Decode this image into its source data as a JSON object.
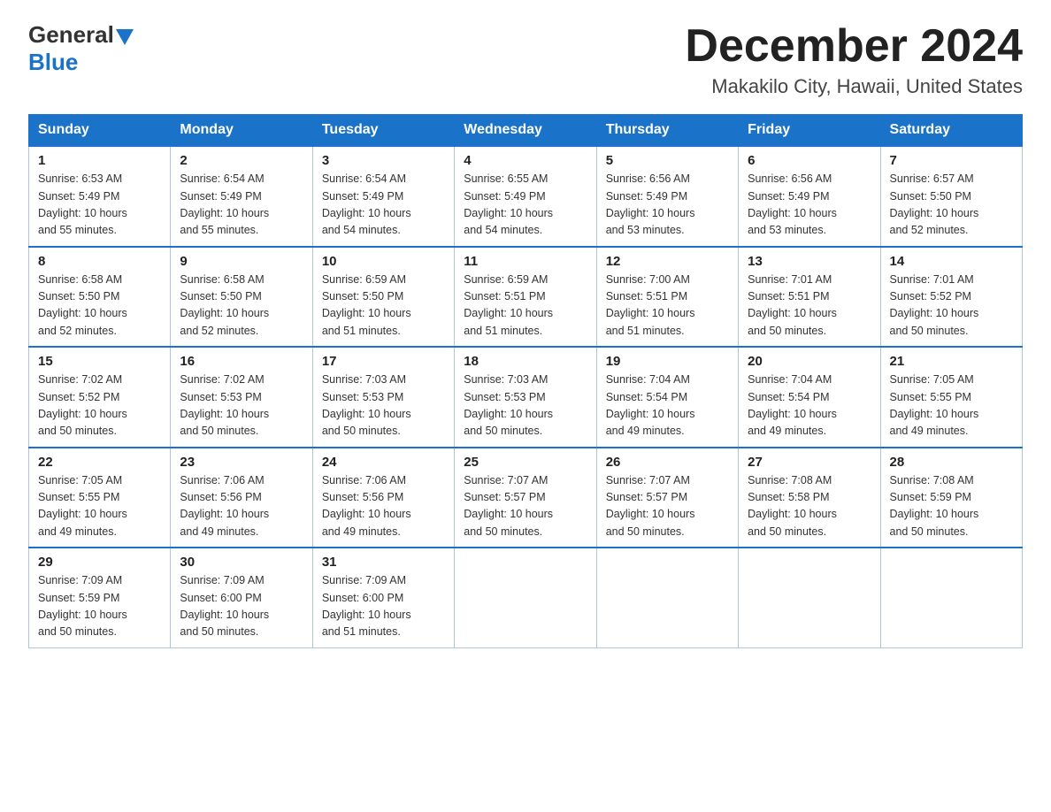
{
  "logo": {
    "general": "General",
    "blue": "Blue"
  },
  "title": "December 2024",
  "location": "Makakilo City, Hawaii, United States",
  "weekdays": [
    "Sunday",
    "Monday",
    "Tuesday",
    "Wednesday",
    "Thursday",
    "Friday",
    "Saturday"
  ],
  "weeks": [
    [
      {
        "day": "1",
        "sunrise": "6:53 AM",
        "sunset": "5:49 PM",
        "daylight": "10 hours and 55 minutes."
      },
      {
        "day": "2",
        "sunrise": "6:54 AM",
        "sunset": "5:49 PM",
        "daylight": "10 hours and 55 minutes."
      },
      {
        "day": "3",
        "sunrise": "6:54 AM",
        "sunset": "5:49 PM",
        "daylight": "10 hours and 54 minutes."
      },
      {
        "day": "4",
        "sunrise": "6:55 AM",
        "sunset": "5:49 PM",
        "daylight": "10 hours and 54 minutes."
      },
      {
        "day": "5",
        "sunrise": "6:56 AM",
        "sunset": "5:49 PM",
        "daylight": "10 hours and 53 minutes."
      },
      {
        "day": "6",
        "sunrise": "6:56 AM",
        "sunset": "5:49 PM",
        "daylight": "10 hours and 53 minutes."
      },
      {
        "day": "7",
        "sunrise": "6:57 AM",
        "sunset": "5:50 PM",
        "daylight": "10 hours and 52 minutes."
      }
    ],
    [
      {
        "day": "8",
        "sunrise": "6:58 AM",
        "sunset": "5:50 PM",
        "daylight": "10 hours and 52 minutes."
      },
      {
        "day": "9",
        "sunrise": "6:58 AM",
        "sunset": "5:50 PM",
        "daylight": "10 hours and 52 minutes."
      },
      {
        "day": "10",
        "sunrise": "6:59 AM",
        "sunset": "5:50 PM",
        "daylight": "10 hours and 51 minutes."
      },
      {
        "day": "11",
        "sunrise": "6:59 AM",
        "sunset": "5:51 PM",
        "daylight": "10 hours and 51 minutes."
      },
      {
        "day": "12",
        "sunrise": "7:00 AM",
        "sunset": "5:51 PM",
        "daylight": "10 hours and 51 minutes."
      },
      {
        "day": "13",
        "sunrise": "7:01 AM",
        "sunset": "5:51 PM",
        "daylight": "10 hours and 50 minutes."
      },
      {
        "day": "14",
        "sunrise": "7:01 AM",
        "sunset": "5:52 PM",
        "daylight": "10 hours and 50 minutes."
      }
    ],
    [
      {
        "day": "15",
        "sunrise": "7:02 AM",
        "sunset": "5:52 PM",
        "daylight": "10 hours and 50 minutes."
      },
      {
        "day": "16",
        "sunrise": "7:02 AM",
        "sunset": "5:53 PM",
        "daylight": "10 hours and 50 minutes."
      },
      {
        "day": "17",
        "sunrise": "7:03 AM",
        "sunset": "5:53 PM",
        "daylight": "10 hours and 50 minutes."
      },
      {
        "day": "18",
        "sunrise": "7:03 AM",
        "sunset": "5:53 PM",
        "daylight": "10 hours and 50 minutes."
      },
      {
        "day": "19",
        "sunrise": "7:04 AM",
        "sunset": "5:54 PM",
        "daylight": "10 hours and 49 minutes."
      },
      {
        "day": "20",
        "sunrise": "7:04 AM",
        "sunset": "5:54 PM",
        "daylight": "10 hours and 49 minutes."
      },
      {
        "day": "21",
        "sunrise": "7:05 AM",
        "sunset": "5:55 PM",
        "daylight": "10 hours and 49 minutes."
      }
    ],
    [
      {
        "day": "22",
        "sunrise": "7:05 AM",
        "sunset": "5:55 PM",
        "daylight": "10 hours and 49 minutes."
      },
      {
        "day": "23",
        "sunrise": "7:06 AM",
        "sunset": "5:56 PM",
        "daylight": "10 hours and 49 minutes."
      },
      {
        "day": "24",
        "sunrise": "7:06 AM",
        "sunset": "5:56 PM",
        "daylight": "10 hours and 49 minutes."
      },
      {
        "day": "25",
        "sunrise": "7:07 AM",
        "sunset": "5:57 PM",
        "daylight": "10 hours and 50 minutes."
      },
      {
        "day": "26",
        "sunrise": "7:07 AM",
        "sunset": "5:57 PM",
        "daylight": "10 hours and 50 minutes."
      },
      {
        "day": "27",
        "sunrise": "7:08 AM",
        "sunset": "5:58 PM",
        "daylight": "10 hours and 50 minutes."
      },
      {
        "day": "28",
        "sunrise": "7:08 AM",
        "sunset": "5:59 PM",
        "daylight": "10 hours and 50 minutes."
      }
    ],
    [
      {
        "day": "29",
        "sunrise": "7:09 AM",
        "sunset": "5:59 PM",
        "daylight": "10 hours and 50 minutes."
      },
      {
        "day": "30",
        "sunrise": "7:09 AM",
        "sunset": "6:00 PM",
        "daylight": "10 hours and 50 minutes."
      },
      {
        "day": "31",
        "sunrise": "7:09 AM",
        "sunset": "6:00 PM",
        "daylight": "10 hours and 51 minutes."
      },
      null,
      null,
      null,
      null
    ]
  ],
  "labels": {
    "sunrise": "Sunrise:",
    "sunset": "Sunset:",
    "daylight": "Daylight:"
  }
}
